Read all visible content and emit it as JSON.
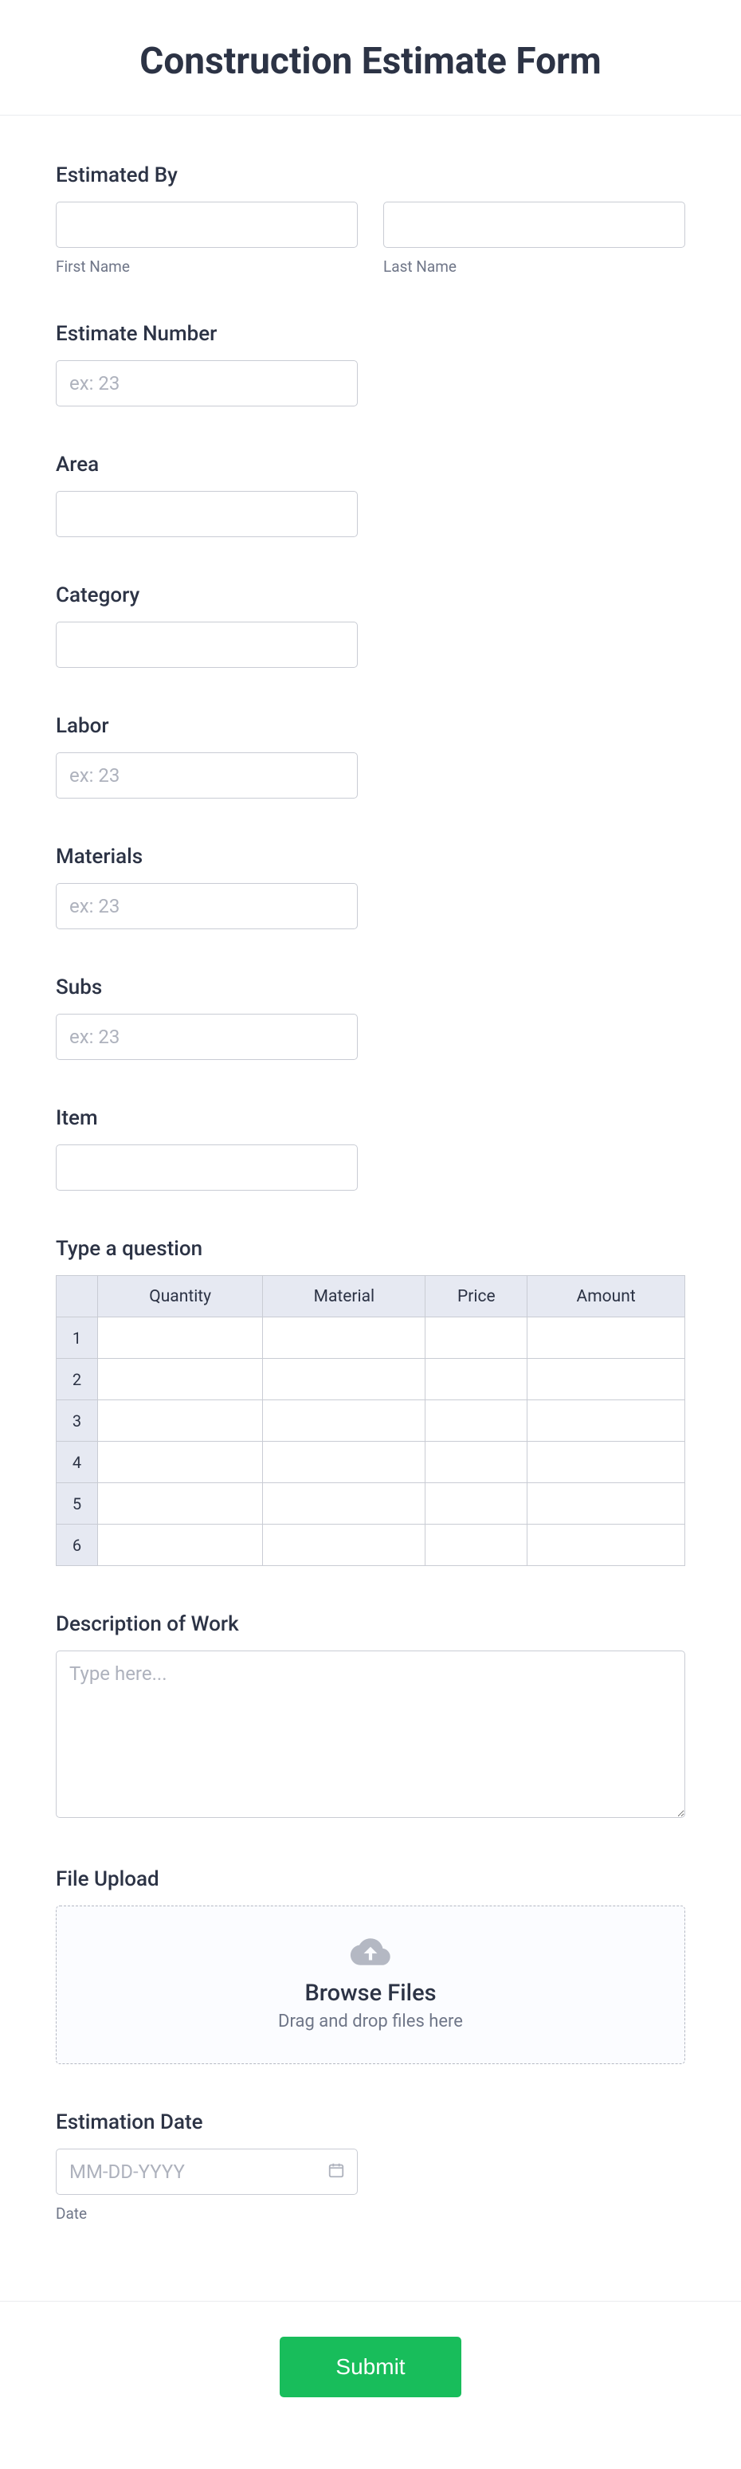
{
  "title": "Construction Estimate Form",
  "fields": {
    "estimatedBy": {
      "label": "Estimated By",
      "firstSub": "First Name",
      "lastSub": "Last Name"
    },
    "estimateNumber": {
      "label": "Estimate Number",
      "placeholder": "ex: 23"
    },
    "area": {
      "label": "Area"
    },
    "category": {
      "label": "Category"
    },
    "labor": {
      "label": "Labor",
      "placeholder": "ex: 23"
    },
    "materials": {
      "label": "Materials",
      "placeholder": "ex: 23"
    },
    "subs": {
      "label": "Subs",
      "placeholder": "ex: 23"
    },
    "item": {
      "label": "Item"
    },
    "table": {
      "label": "Type a question",
      "headers": [
        "Quantity",
        "Material",
        "Price",
        "Amount"
      ],
      "rows": [
        "1",
        "2",
        "3",
        "4",
        "5",
        "6"
      ]
    },
    "description": {
      "label": "Description of Work",
      "placeholder": "Type here..."
    },
    "upload": {
      "label": "File Upload",
      "browse": "Browse Files",
      "hint": "Drag and drop files here"
    },
    "date": {
      "label": "Estimation Date",
      "placeholder": "MM-DD-YYYY",
      "sub": "Date"
    }
  },
  "submit": "Submit"
}
